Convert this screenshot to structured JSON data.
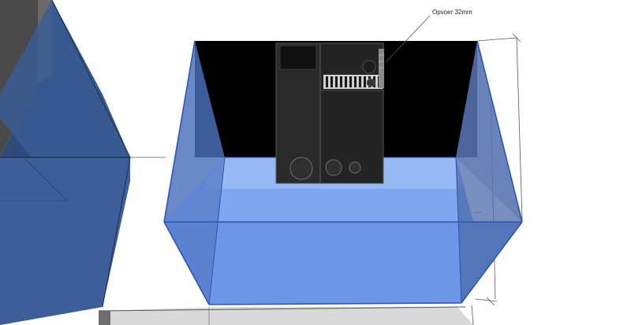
{
  "annotation": {
    "label": "Opvoer 32mm"
  },
  "colors": {
    "background": "#ffffff",
    "back_wall": "#000000",
    "glass_blue": "#4f72b8",
    "water_blue": "#6e9ae8",
    "tank_edge": "#2f56b8",
    "dimension_line": "#444444",
    "left_cabinet": "#2d4a78",
    "bottom_cabinet": "#d7d7d7"
  },
  "objects": {
    "tank": "glass-aquarium",
    "overflow_box": "return-overflow-box",
    "comb": "overflow-comb",
    "cabinet_left": "cabinet-left",
    "cabinet_bottom": "cabinet-bottom"
  }
}
